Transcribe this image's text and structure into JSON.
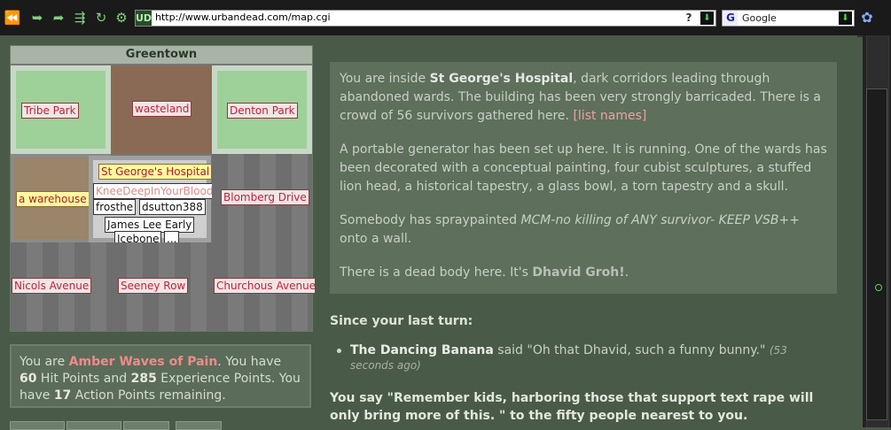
{
  "browser": {
    "nav_icons": [
      "back-arrow-icon",
      "forward-arrow-icon",
      "reload-icon",
      "home-icon",
      "stop-icon",
      "tools-icon"
    ],
    "url_icon_text": "UD",
    "url": "http://www.urbandead.com/map.cgi",
    "help_icon": "?",
    "search_engine": "G",
    "search_placeholder": "Google"
  },
  "map": {
    "title": "Greentown",
    "cells": {
      "tribe_park": "Tribe Park",
      "wasteland": "wasteland",
      "denton_park": "Denton Park",
      "warehouse": "a warehouse",
      "hospital": "St George's Hospital",
      "blomberg": "Blomberg Drive",
      "nicols": "Nicols Avenue",
      "seeney": "Seeney Row",
      "churchous": "Churchous Avenue"
    },
    "survivors": {
      "s1": "KneeDeepInYourBlood",
      "s2": "frosthe",
      "s3": "dsutton388",
      "s4": "James Lee Early",
      "s5": "Icebone",
      "more": "..."
    }
  },
  "status": {
    "prefix": "You are ",
    "name": "Amber Waves of Pain",
    "mid1": ". You have ",
    "hp": "60",
    "mid2": " Hit Points and ",
    "xp": "285",
    "mid3": " Experience Points. You have ",
    "ap": "17",
    "suffix": " Action Points remaining."
  },
  "description": {
    "p1_a": "You are inside ",
    "p1_place": "St George's Hospital",
    "p1_b": ", dark corridors leading through abandoned wards. The building has been very strongly barricaded. There is a crowd of 56 survivors gathered here. ",
    "p1_link": "[list names]",
    "p2": "A portable generator has been set up here. It is running. One of the wards has been decorated with a conceptual painting, four cubist sculptures, a stuffed lion head, a historical tapestry, a glass bowl, a torn tapestry and a skull.",
    "p3_a": "Somebody has spraypainted ",
    "p3_graffiti": "MCM-no killing of ANY survivor- KEEP VSB++",
    "p3_b": " onto a wall.",
    "p4_a": "There is a dead body here. It's ",
    "p4_body": "Dhavid Groh!",
    "p4_b": "."
  },
  "events": {
    "heading": "Since your last turn:",
    "speaker": "The Dancing Banana",
    "said": " said \"Oh that Dhavid, such a funny bunny.\" ",
    "time": "(53 seconds ago)"
  },
  "you_say": "You say \"Remember kids, harboring those that support text rape will only bring more of this. \" to the fifty people nearest to you."
}
